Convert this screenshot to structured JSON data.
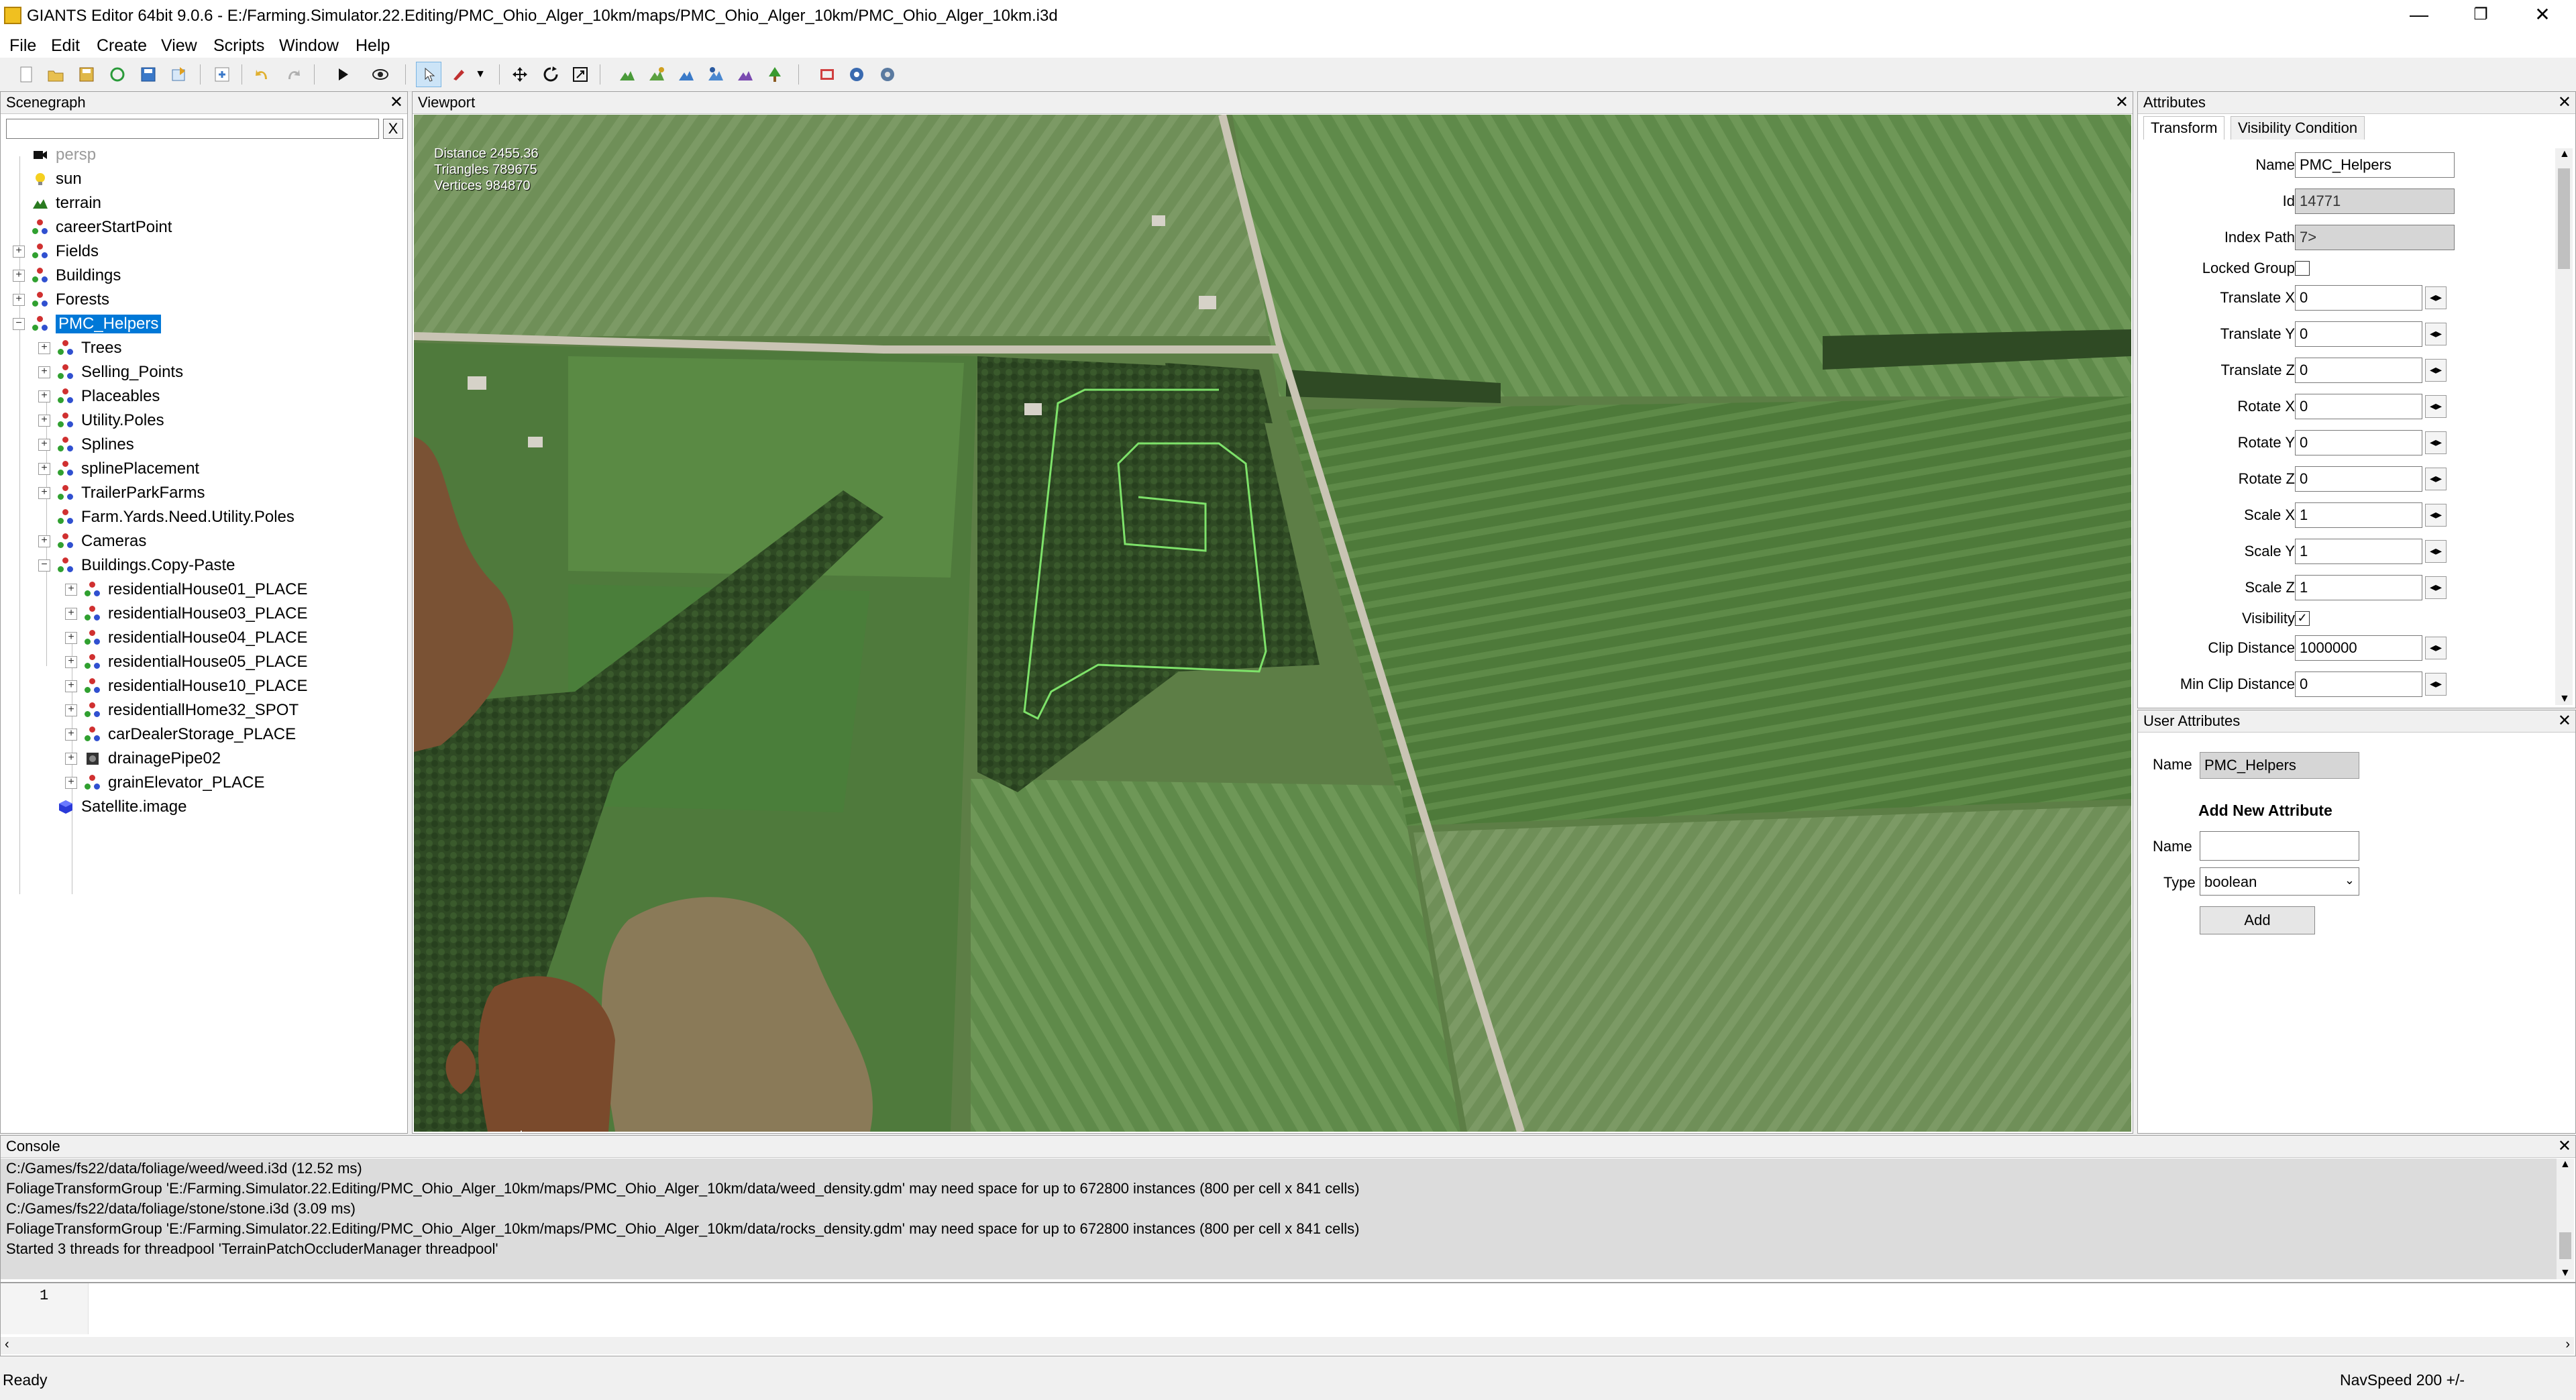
{
  "window": {
    "title": "GIANTS Editor 64bit 9.0.6 - E:/Farming.Simulator.22.Editing/PMC_Ohio_Alger_10km/maps/PMC_Ohio_Alger_10km/PMC_Ohio_Alger_10km.i3d",
    "minimize": "—",
    "restore": "❐",
    "close": "✕"
  },
  "menu": [
    "File",
    "Edit",
    "Create",
    "View",
    "Scripts",
    "Window",
    "Help"
  ],
  "toolbar_icons": [
    "new-icon",
    "open-icon",
    "save-icon",
    "reload-icon",
    "save-as-icon",
    "export-icon",
    "import-icon",
    "undo-icon",
    "redo-icon",
    "play-icon",
    "visibility-icon",
    "select-icon",
    "paint-icon",
    "move-icon",
    "rotate-icon",
    "scale-icon",
    "terrain-sculpt-icon",
    "terrain-paint-icon",
    "foliage-paint-icon",
    "terrain-info-icon",
    "texture-paint-icon",
    "tree-paint-icon",
    "gear-a-icon",
    "gear-b-icon",
    "gear-c-icon"
  ],
  "scenegraph": {
    "title": "Scenegraph",
    "search_clear": "X",
    "nodes": [
      {
        "label": "persp"
      },
      {
        "label": "sun"
      },
      {
        "label": "terrain"
      },
      {
        "label": "careerStartPoint"
      },
      {
        "label": "Fields"
      },
      {
        "label": "Buildings"
      },
      {
        "label": "Forests"
      },
      {
        "label": "PMC_Helpers"
      },
      {
        "label": "Trees"
      },
      {
        "label": "Selling_Points"
      },
      {
        "label": "Placeables"
      },
      {
        "label": "Utility.Poles"
      },
      {
        "label": "Splines"
      },
      {
        "label": "splinePlacement"
      },
      {
        "label": "TrailerParkFarms"
      },
      {
        "label": "Farm.Yards.Need.Utility.Poles"
      },
      {
        "label": "Cameras"
      },
      {
        "label": "Buildings.Copy-Paste"
      },
      {
        "label": "residentialHouse01_PLACE"
      },
      {
        "label": "residentialHouse03_PLACE"
      },
      {
        "label": "residentialHouse04_PLACE"
      },
      {
        "label": "residentialHouse05_PLACE"
      },
      {
        "label": "residentialHouse10_PLACE"
      },
      {
        "label": "residentiallHome32_SPOT"
      },
      {
        "label": "carDealerStorage_PLACE"
      },
      {
        "label": "drainagePipe02"
      },
      {
        "label": "grainElevator_PLACE"
      },
      {
        "label": "Satellite.image"
      }
    ]
  },
  "viewport": {
    "title": "Viewport",
    "stats": [
      "Distance 2455.36",
      "Triangles 789675",
      "Vertices 984870"
    ],
    "camera": "camera_top_down",
    "spline_color": "#7ee26a"
  },
  "attributes": {
    "title": "Attributes",
    "tabs": [
      "Transform",
      "Visibility Condition"
    ],
    "fields": {
      "name": {
        "label": "Name",
        "value": "PMC_Helpers"
      },
      "id": {
        "label": "Id",
        "value": "14771"
      },
      "index_path": {
        "label": "Index Path",
        "value": "7>"
      },
      "locked_group": {
        "label": "Locked Group"
      },
      "translate_x": {
        "label": "Translate X",
        "value": "0"
      },
      "translate_y": {
        "label": "Translate Y",
        "value": "0"
      },
      "translate_z": {
        "label": "Translate Z",
        "value": "0"
      },
      "rotate_x": {
        "label": "Rotate X",
        "value": "0"
      },
      "rotate_y": {
        "label": "Rotate Y",
        "value": "0"
      },
      "rotate_z": {
        "label": "Rotate Z",
        "value": "0"
      },
      "scale_x": {
        "label": "Scale X",
        "value": "1"
      },
      "scale_y": {
        "label": "Scale Y",
        "value": "1"
      },
      "scale_z": {
        "label": "Scale Z",
        "value": "1"
      },
      "visibility": {
        "label": "Visibility",
        "checked": "✓"
      },
      "clip_distance": {
        "label": "Clip Distance",
        "value": "1000000"
      },
      "min_clip_distance": {
        "label": "Min Clip Distance",
        "value": "0"
      }
    }
  },
  "user_attributes": {
    "title": "User Attributes",
    "name_label": "Name",
    "name_value": "PMC_Helpers",
    "add_heading": "Add New Attribute",
    "new_name_label": "Name",
    "type_label": "Type",
    "type_value": "boolean",
    "add_button": "Add"
  },
  "console": {
    "title": "Console",
    "lines": [
      "C:/Games/fs22/data/foliage/weed/weed.i3d (12.52 ms)",
      "FoliageTransformGroup 'E:/Farming.Simulator.22.Editing/PMC_Ohio_Alger_10km/maps/PMC_Ohio_Alger_10km/data/weed_density.gdm' may need space for up to 672800 instances (800 per cell x 841 cells)",
      "C:/Games/fs22/data/foliage/stone/stone.i3d (3.09 ms)",
      "FoliageTransformGroup 'E:/Farming.Simulator.22.Editing/PMC_Ohio_Alger_10km/maps/PMC_Ohio_Alger_10km/data/rocks_density.gdm' may need space for up to 672800 instances (800 per cell x 841 cells)",
      "Started 3 threads for threadpool 'TerrainPatchOccluderManager threadpool'"
    ],
    "line_number": "1"
  },
  "status": {
    "left": "Ready",
    "right": "NavSpeed 200 +/-"
  }
}
